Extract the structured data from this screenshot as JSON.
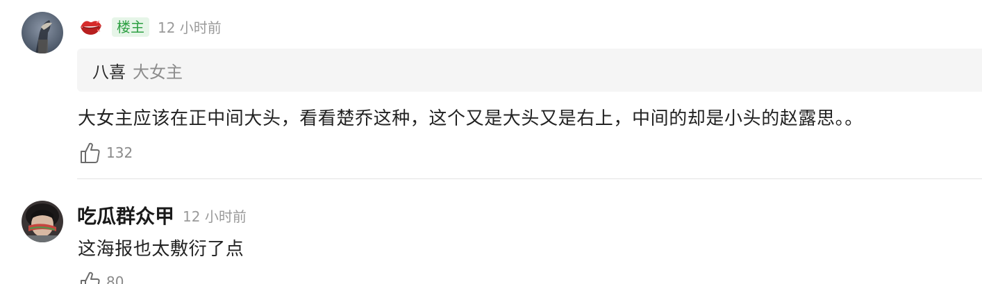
{
  "comments": [
    {
      "author_badge": "楼主",
      "timestamp": "12 小时前",
      "quote": {
        "user": "八喜",
        "text": "大女主"
      },
      "text": "大女主应该在正中间大头，看看楚乔这种，这个又是大头又是右上，中间的却是小头的赵露思。。",
      "likes": "132",
      "icons": {
        "emoji": "lips-icon",
        "like": "thumbs-up-icon"
      }
    },
    {
      "author": "吃瓜群众甲",
      "timestamp": "12 小时前",
      "text": "这海报也太敷衍了点",
      "likes": "80",
      "icons": {
        "like": "thumbs-up-icon"
      }
    }
  ],
  "colors": {
    "badge_bg": "#e6f5e8",
    "badge_text": "#2ea043",
    "quote_bg": "#f5f5f5",
    "muted_text": "#9a9a9a",
    "lips": "#d62a2a"
  }
}
